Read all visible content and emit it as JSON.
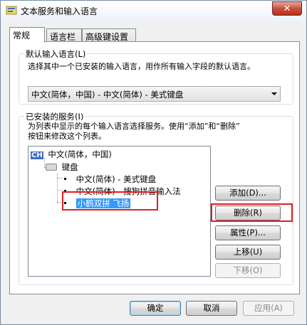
{
  "window": {
    "title": "文本服务和输入语言",
    "close_symbol": "✕"
  },
  "tabs": [
    {
      "label": "常规"
    },
    {
      "label": "语言栏"
    },
    {
      "label": "高级键设置"
    }
  ],
  "default_lang": {
    "legend": "默认输入语言(L)",
    "description": "选择其中一个已安装的输入语言，用作所有输入字段的默认语言。",
    "selected": "中文(简体，中国) - 中文(简体) - 美式键盘"
  },
  "installed": {
    "legend": "已安装的服务(I)",
    "description_line1": "为列表中显示的每个输入语言选择服务。使用“添加”和“删除”",
    "description_line2": "按钮来修改这个列表。",
    "tree": {
      "language_badge": "CH",
      "language": "中文(简体，中国)",
      "category": "键盘",
      "items": [
        "中文(简体) - 美式键盘",
        "中文(简体) - 搜狗拼音输入法",
        "小鹤双拼 飞扬"
      ]
    }
  },
  "buttons": {
    "add": "添加(D)...",
    "remove": "删除(R)",
    "properties": "属性(P)...",
    "move_up": "上移(U)",
    "move_down": "下移(O)"
  },
  "footer": {
    "ok": "确定",
    "cancel": "取消",
    "apply": "应用(A)"
  },
  "colors": {
    "selection": "#3399ff",
    "highlight_box": "#e02020"
  }
}
